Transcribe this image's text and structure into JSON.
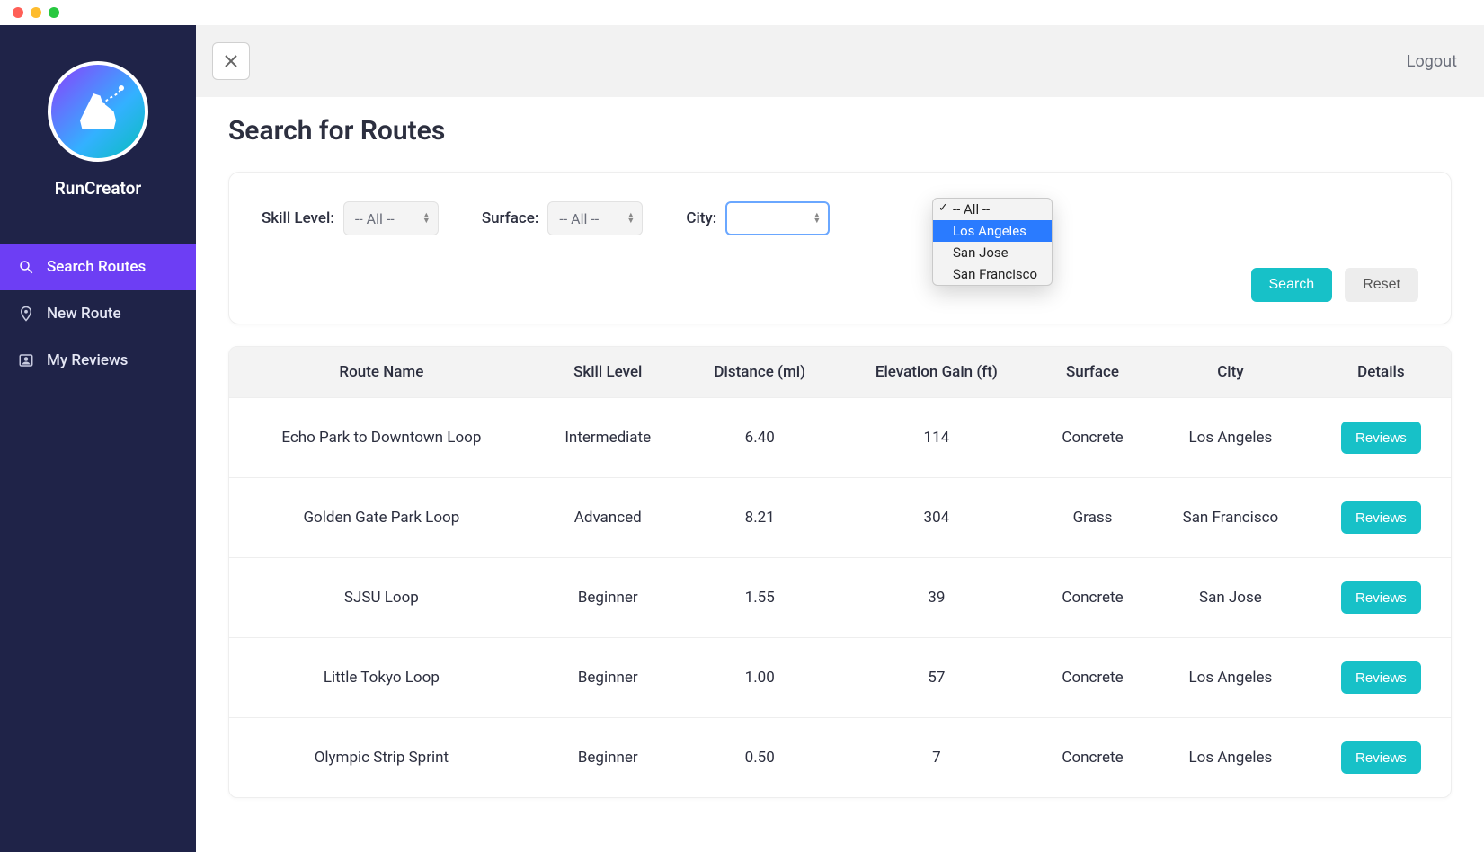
{
  "brand": {
    "name": "RunCreator"
  },
  "sidebar": {
    "items": [
      {
        "label": "Search Routes"
      },
      {
        "label": "New Route"
      },
      {
        "label": "My Reviews"
      }
    ]
  },
  "header": {
    "logout": "Logout"
  },
  "page": {
    "title": "Search for Routes"
  },
  "filters": {
    "skill_label": "Skill Level:",
    "skill_value": "-- All --",
    "surface_label": "Surface:",
    "surface_value": "-- All --",
    "city_label": "City:"
  },
  "city_dropdown": {
    "options": [
      {
        "label": "-- All --",
        "selected": true,
        "hover": false
      },
      {
        "label": "Los Angeles",
        "selected": false,
        "hover": true
      },
      {
        "label": "San Jose",
        "selected": false,
        "hover": false
      },
      {
        "label": "San Francisco",
        "selected": false,
        "hover": false
      }
    ]
  },
  "actions": {
    "search": "Search",
    "reset": "Reset"
  },
  "table": {
    "headers": [
      "Route Name",
      "Skill Level",
      "Distance (mi)",
      "Elevation Gain (ft)",
      "Surface",
      "City",
      "Details"
    ],
    "details_button": "Reviews",
    "rows": [
      {
        "name": "Echo Park to Downtown Loop",
        "skill": "Intermediate",
        "distance": "6.40",
        "elevation": "114",
        "surface": "Concrete",
        "city": "Los Angeles"
      },
      {
        "name": "Golden Gate Park Loop",
        "skill": "Advanced",
        "distance": "8.21",
        "elevation": "304",
        "surface": "Grass",
        "city": "San Francisco"
      },
      {
        "name": "SJSU Loop",
        "skill": "Beginner",
        "distance": "1.55",
        "elevation": "39",
        "surface": "Concrete",
        "city": "San Jose"
      },
      {
        "name": "Little Tokyo Loop",
        "skill": "Beginner",
        "distance": "1.00",
        "elevation": "57",
        "surface": "Concrete",
        "city": "Los Angeles"
      },
      {
        "name": "Olympic Strip Sprint",
        "skill": "Beginner",
        "distance": "0.50",
        "elevation": "7",
        "surface": "Concrete",
        "city": "Los Angeles"
      }
    ]
  },
  "colors": {
    "accent": "#17c1c8",
    "sidebar": "#1f2348",
    "active": "#6d3ef4"
  }
}
